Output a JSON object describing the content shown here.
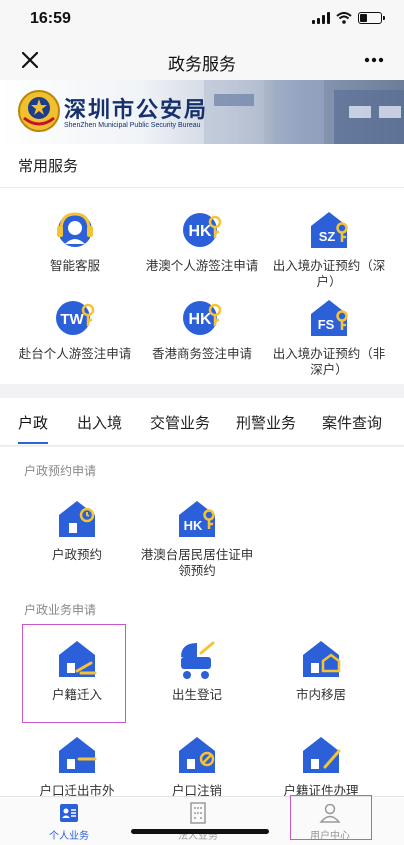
{
  "status": {
    "time": "16:59",
    "battery_level": 0.35
  },
  "nav": {
    "title": "政务服务"
  },
  "banner": {
    "title": "深圳市公安局",
    "subtitle": "ShenZhen Municipal Public Security Bureau"
  },
  "common": {
    "header": "常用服务",
    "items": [
      {
        "label": "智能客服",
        "icon": "customer-service-icon"
      },
      {
        "label": "港澳个人游签注申请",
        "icon": "hk-badge-icon",
        "badge": "HK"
      },
      {
        "label": "出入境办证预约（深户）",
        "icon": "szr-house-icon",
        "badge": "SZR"
      },
      {
        "label": "赴台个人游签注申请",
        "icon": "tw-badge-icon",
        "badge": "TW"
      },
      {
        "label": "香港商务签注申请",
        "icon": "hk-badge-icon",
        "badge": "HK"
      },
      {
        "label": "出入境办证预约（非深户）",
        "icon": "fsr-house-icon",
        "badge": "FSR"
      }
    ]
  },
  "tabs": [
    {
      "label": "户政"
    },
    {
      "label": "出入境"
    },
    {
      "label": "交管业务"
    },
    {
      "label": "刑警业务"
    },
    {
      "label": "案件查询"
    }
  ],
  "huzheng": {
    "booking_header": "户政预约申请",
    "booking_items": [
      {
        "label": "户政预约",
        "icon": "house-clock-icon"
      },
      {
        "label": "港澳台居民居住证申领预约",
        "icon": "hk-house-icon",
        "badge": "HK"
      }
    ],
    "business_header": "户政业务申请",
    "business_items": [
      {
        "label": "户籍迁入",
        "icon": "house-move-in-icon"
      },
      {
        "label": "出生登记",
        "icon": "baby-stroller-icon"
      },
      {
        "label": "市内移居",
        "icon": "house-relocate-icon"
      },
      {
        "label": "户口迁出市外",
        "icon": "house-move-out-icon"
      },
      {
        "label": "户口注销",
        "icon": "house-cancel-icon"
      },
      {
        "label": "户籍证件办理",
        "icon": "house-certificate-icon"
      }
    ]
  },
  "tabbar": [
    {
      "label": "个人业务",
      "icon": "personal-business-icon"
    },
    {
      "label": "法人业务",
      "icon": "corporate-building-icon"
    },
    {
      "label": "用户中心",
      "icon": "user-center-icon"
    }
  ],
  "colors": {
    "primary": "#2b60d8",
    "icon_accent": "#f5c335",
    "highlight": "#c957c9"
  }
}
